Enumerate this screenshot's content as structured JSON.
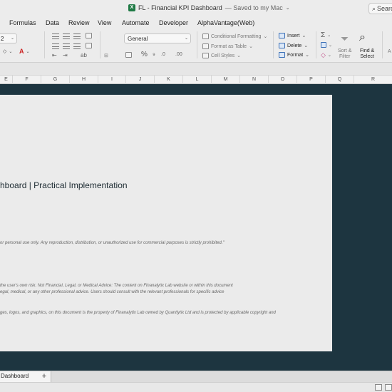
{
  "window": {
    "title": "FL - Financial KPI Dashboard",
    "save_status": "— Saved to my Mac",
    "app_icon": "excel-logo-icon",
    "search_label": "Searc"
  },
  "menu": {
    "tabs": [
      "Formulas",
      "Data",
      "Review",
      "View",
      "Automate",
      "Developer",
      "AlphaVantage(Web)"
    ]
  },
  "ribbon": {
    "font_size_value": "2",
    "number_format": "General",
    "conditional_formatting": "Conditional Formatting",
    "format_as_table": "Format as Table",
    "cell_styles": "Cell Styles",
    "insert": "Insert",
    "delete": "Delete",
    "format": "Format",
    "sort_filter_line1": "Sort &",
    "sort_filter_line2": "Filter",
    "find_select_line1": "Find &",
    "find_select_line2": "Select",
    "partial_right": "A"
  },
  "columns": [
    "E",
    "F",
    "G",
    "H",
    "I",
    "J",
    "K",
    "L",
    "M",
    "N",
    "O",
    "P",
    "Q",
    "R"
  ],
  "document": {
    "title": "hboard |  Practical Implementation",
    "copyright_line": "or personal use only. Any reproduction, distribution, or unauthorized use for commercial purposes is strictly prohibited.\"",
    "disclaimer_line1": "the user's own risk. Not Financial, Legal, or Medical Advice: The content on Finanalytix Lab website or within this document",
    "disclaimer_line2": "egal, medical, or any other professional advice. Users should consult with the relevant professionals for specific advice",
    "ip_line": "ges, logos, and graphics, on this document is the property of Finanalytix Lab owned by Quantlytix Ltd and is protected by applicable copyright and"
  },
  "sheet_tabs": {
    "active": "Dashboard",
    "add_label": "+"
  }
}
